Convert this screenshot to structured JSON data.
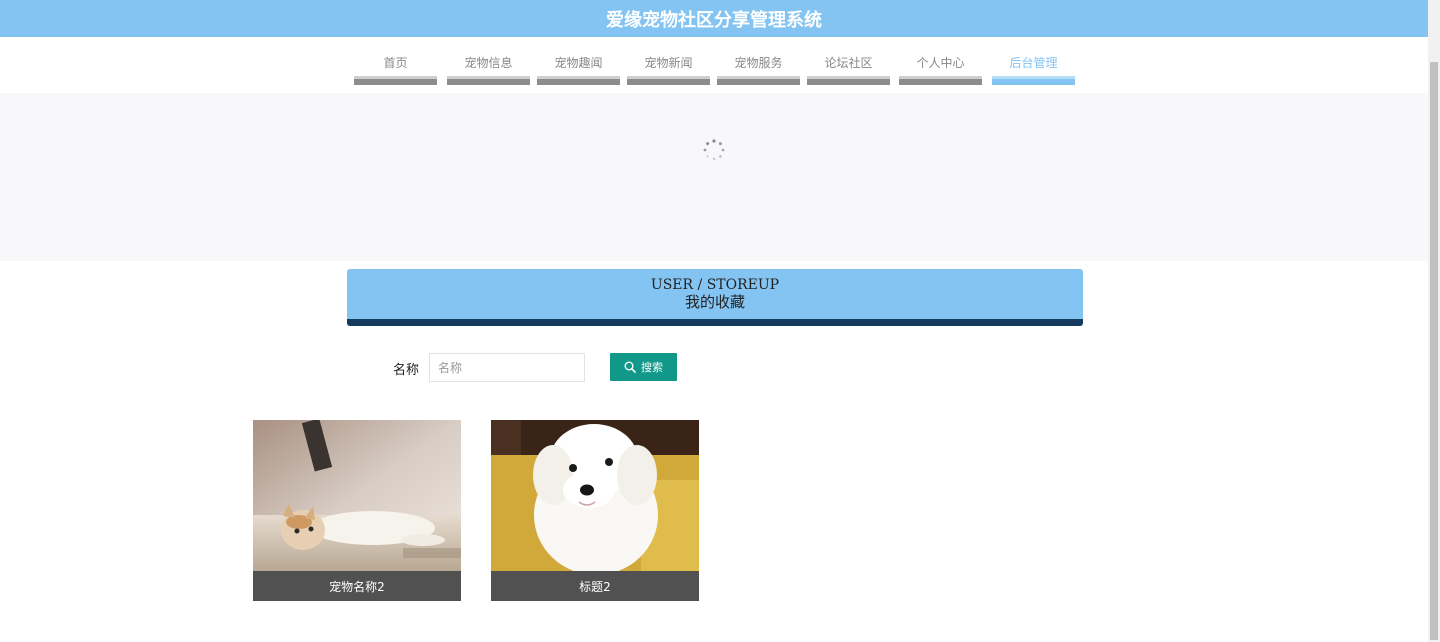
{
  "header": {
    "title": "爱缘宠物社区分享管理系统"
  },
  "nav": {
    "items": [
      {
        "label": "首页",
        "active": false
      },
      {
        "label": "宠物信息",
        "active": false
      },
      {
        "label": "宠物趣闻",
        "active": false
      },
      {
        "label": "宠物新闻",
        "active": false
      },
      {
        "label": "宠物服务",
        "active": false
      },
      {
        "label": "论坛社区",
        "active": false
      },
      {
        "label": "个人中心",
        "active": false
      },
      {
        "label": "后台管理",
        "active": true
      }
    ]
  },
  "section": {
    "title_en": "USER / STOREUP",
    "title_cn": "我的收藏"
  },
  "search": {
    "label": "名称",
    "placeholder": "名称",
    "value": "",
    "button_label": "搜索"
  },
  "cards": [
    {
      "caption": "宠物名称2",
      "image": "cat-photo"
    },
    {
      "caption": "标题2",
      "image": "dog-photo"
    }
  ],
  "colors": {
    "primary": "#83c4f2",
    "title_underline": "#143a5c",
    "search_button": "#119888",
    "caption_bg": "#515151"
  }
}
